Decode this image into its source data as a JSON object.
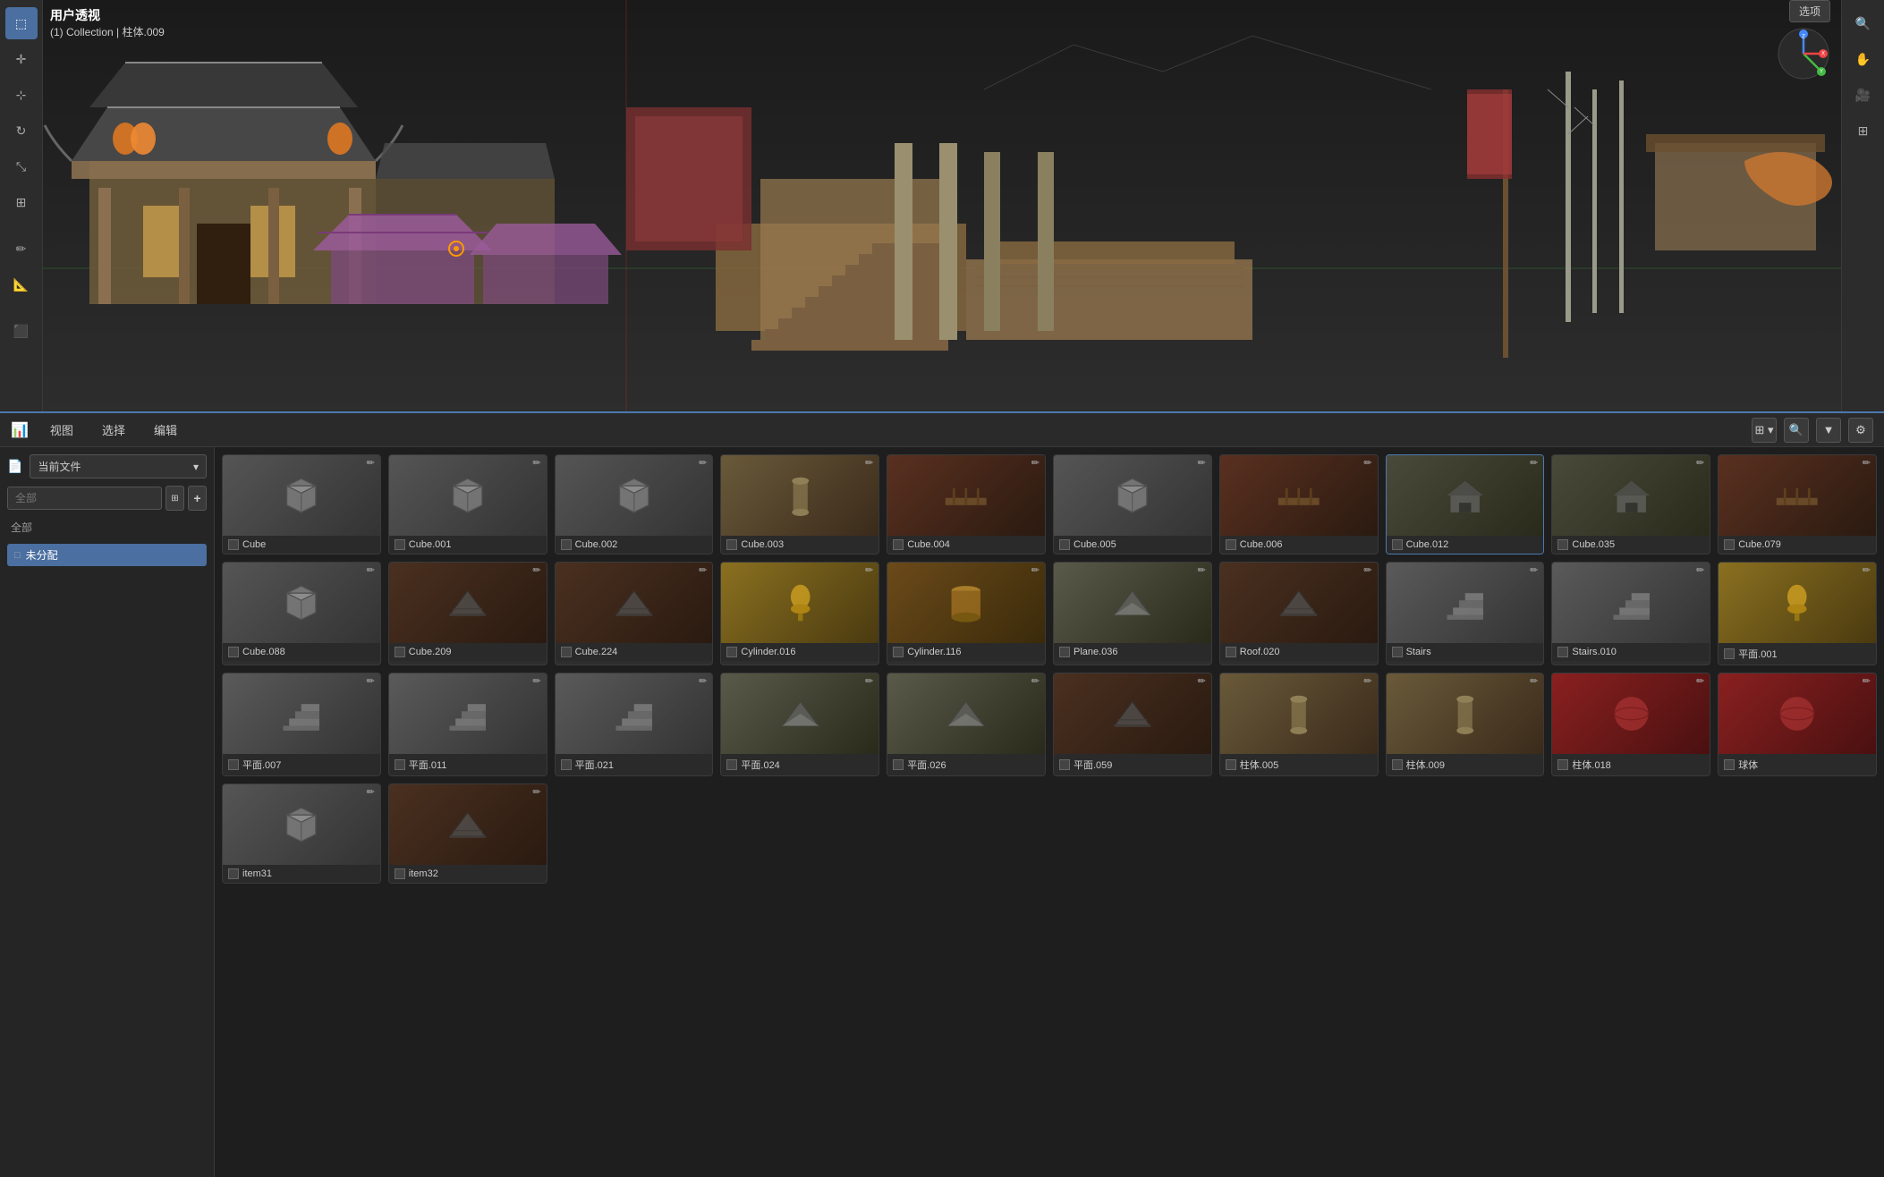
{
  "viewport": {
    "view_name": "用户透视",
    "collection_info": "(1) Collection | 柱体.009"
  },
  "toolbar_left": {
    "buttons": [
      {
        "name": "select-box",
        "icon": "⬚",
        "tooltip": "Select Box",
        "active": true
      },
      {
        "name": "cursor",
        "icon": "✛",
        "tooltip": "Cursor"
      },
      {
        "name": "move",
        "icon": "⊹",
        "tooltip": "Move"
      },
      {
        "name": "rotate",
        "icon": "↻",
        "tooltip": "Rotate"
      },
      {
        "name": "scale",
        "icon": "⤡",
        "tooltip": "Scale"
      },
      {
        "name": "transform",
        "icon": "⊞",
        "tooltip": "Transform"
      },
      {
        "name": "separator1",
        "icon": "",
        "tooltip": ""
      },
      {
        "name": "annotate",
        "icon": "✏",
        "tooltip": "Annotate"
      },
      {
        "name": "measure",
        "icon": "📐",
        "tooltip": "Measure"
      },
      {
        "name": "separator2",
        "icon": "",
        "tooltip": ""
      },
      {
        "name": "add-cube",
        "icon": "⬛",
        "tooltip": "Add Cube"
      }
    ]
  },
  "toolbar_right": {
    "buttons": [
      {
        "name": "view-zoom",
        "icon": "🔍",
        "tooltip": "Zoom"
      },
      {
        "name": "view-pan",
        "icon": "✋",
        "tooltip": "Pan"
      },
      {
        "name": "camera",
        "icon": "🎥",
        "tooltip": "Camera"
      },
      {
        "name": "grid",
        "icon": "⊞",
        "tooltip": "Grid"
      }
    ]
  },
  "options_button": "选项",
  "panel": {
    "toolbar": {
      "icon": "📊",
      "menus": [
        "视图",
        "选择",
        "编辑"
      ],
      "view_mode_icon": "⊞",
      "search_icon": "🔍",
      "filter_icon": "▼",
      "settings_icon": "⚙"
    },
    "sidebar": {
      "file_label": "当前文件",
      "file_dropdown_arrow": "▾",
      "search_placeholder": "全部",
      "add_icon": "+",
      "filter_icon": "⊞",
      "category_label": "全部",
      "unassigned_label": "未分配",
      "unassigned_active": true
    },
    "assets": [
      {
        "name": "Cube",
        "thumb_type": "cube",
        "selected": false,
        "row": 0
      },
      {
        "name": "Cube.001",
        "thumb_type": "cube",
        "selected": false,
        "row": 0
      },
      {
        "name": "Cube.002",
        "thumb_type": "cube",
        "selected": false,
        "row": 0
      },
      {
        "name": "Cube.003",
        "thumb_type": "pillar",
        "selected": false,
        "row": 0
      },
      {
        "name": "Cube.004",
        "thumb_type": "bridge",
        "selected": false,
        "row": 0
      },
      {
        "name": "Cube.005",
        "thumb_type": "cube",
        "selected": false,
        "row": 0
      },
      {
        "name": "Cube.006",
        "thumb_type": "bridge",
        "selected": false,
        "row": 0
      },
      {
        "name": "Cube.012",
        "thumb_type": "building",
        "selected": true,
        "row": 0
      },
      {
        "name": "Cube.035",
        "thumb_type": "building",
        "selected": false,
        "row": 0
      },
      {
        "name": "Cube.079",
        "thumb_type": "bridge",
        "selected": false,
        "row": 0
      },
      {
        "name": "Cube.088",
        "thumb_type": "cube",
        "selected": false,
        "row": 1
      },
      {
        "name": "Cube.209",
        "thumb_type": "roof",
        "selected": false,
        "row": 1
      },
      {
        "name": "Cube.224",
        "thumb_type": "roof",
        "selected": false,
        "row": 1
      },
      {
        "name": "Cylinder.016",
        "thumb_type": "light",
        "selected": false,
        "row": 1
      },
      {
        "name": "Cylinder.116",
        "thumb_type": "cylinder",
        "selected": false,
        "row": 1
      },
      {
        "name": "Plane.036",
        "thumb_type": "plane",
        "selected": false,
        "row": 1
      },
      {
        "name": "Roof.020",
        "thumb_type": "roof",
        "selected": false,
        "row": 1
      },
      {
        "name": "Stairs",
        "thumb_type": "stairs",
        "selected": false,
        "row": 1
      },
      {
        "name": "Stairs.010",
        "thumb_type": "stairs",
        "selected": false,
        "row": 1
      },
      {
        "name": "平面.001",
        "thumb_type": "light",
        "selected": false,
        "row": 1
      },
      {
        "name": "平面.007",
        "thumb_type": "stairs",
        "selected": false,
        "row": 2
      },
      {
        "name": "平面.011",
        "thumb_type": "stairs",
        "selected": false,
        "row": 2
      },
      {
        "name": "平面.021",
        "thumb_type": "stairs",
        "selected": false,
        "row": 2
      },
      {
        "name": "平面.024",
        "thumb_type": "plane",
        "selected": false,
        "row": 2
      },
      {
        "name": "平面.026",
        "thumb_type": "plane",
        "selected": false,
        "row": 2
      },
      {
        "name": "平面.059",
        "thumb_type": "roof",
        "selected": false,
        "row": 2
      },
      {
        "name": "柱体.005",
        "thumb_type": "pillar",
        "selected": false,
        "row": 2
      },
      {
        "name": "柱体.009",
        "thumb_type": "pillar",
        "selected": false,
        "row": 2
      },
      {
        "name": "柱体.018",
        "thumb_type": "sphere",
        "selected": false,
        "row": 2
      },
      {
        "name": "球体",
        "thumb_type": "sphere",
        "selected": false,
        "row": 2
      },
      {
        "name": "item31",
        "thumb_type": "cube",
        "selected": false,
        "row": 3
      },
      {
        "name": "item32",
        "thumb_type": "roof",
        "selected": false,
        "row": 3
      }
    ]
  },
  "axis": {
    "z_color": "#4488ff",
    "y_color": "#44bb44",
    "x_color": "#ee4444"
  }
}
